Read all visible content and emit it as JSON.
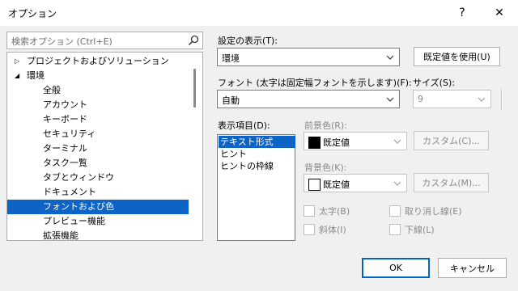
{
  "window": {
    "title": "オプション",
    "help": "?",
    "close": "✕"
  },
  "search": {
    "placeholder": "検索オプション (Ctrl+E)"
  },
  "tree": {
    "items": [
      {
        "label": "プロジェクトおよびソリューション",
        "arrow": "▷"
      },
      {
        "label": "環境",
        "arrow": "◢"
      },
      {
        "label": "全般"
      },
      {
        "label": "アカウント"
      },
      {
        "label": "キーボード"
      },
      {
        "label": "セキュリティ"
      },
      {
        "label": "ターミナル"
      },
      {
        "label": "タスク一覧"
      },
      {
        "label": "タブとウィンドウ"
      },
      {
        "label": "ドキュメント"
      },
      {
        "label": "フォントおよび色"
      },
      {
        "label": "プレビュー機能"
      },
      {
        "label": "拡張機能"
      }
    ]
  },
  "settings": {
    "show_label": "設定の表示(T):",
    "show_value": "環境",
    "use_defaults": "既定値を使用(U)",
    "font_label": "フォント (太字は固定幅フォントを示します)(F):",
    "font_value": "自動",
    "size_label": "サイズ(S):",
    "size_value": "9",
    "display_items_label": "表示項目(D):",
    "display_items": [
      "テキスト形式",
      "ヒント",
      "ヒントの枠線"
    ],
    "foreground_label": "前景色(R):",
    "foreground_value": "既定値",
    "foreground_swatch": "#000000",
    "background_label": "背景色(K):",
    "background_value": "既定値",
    "background_swatch": "#ffffff",
    "custom_fg": "カスタム(C)...",
    "custom_bg": "カスタム(M)...",
    "bold": "太字(B)",
    "italic": "斜体(I)",
    "strikethrough": "取り消し線(E)",
    "underline": "下線(L)"
  },
  "footer": {
    "ok": "OK",
    "cancel": "キャンセル"
  },
  "colors": {
    "selection": "#0e63c6",
    "accent": "#0067c0"
  }
}
